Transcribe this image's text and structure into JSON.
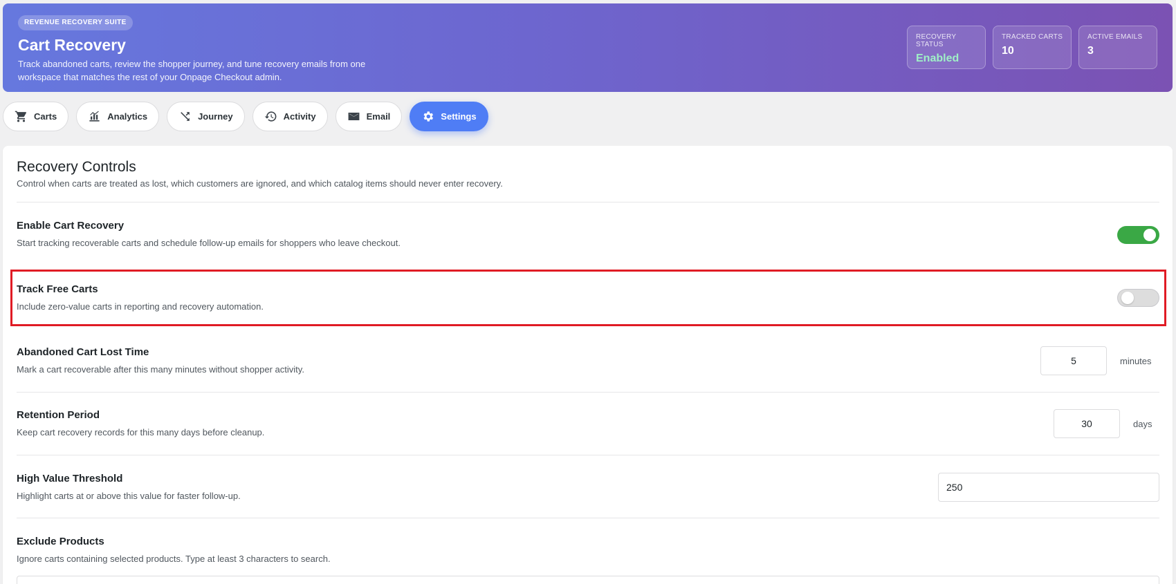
{
  "header": {
    "badge": "REVENUE RECOVERY SUITE",
    "title": "Cart Recovery",
    "description": "Track abandoned carts, review the shopper journey, and tune recovery emails from one workspace that matches the rest of your Onpage Checkout admin.",
    "stats": [
      {
        "label": "RECOVERY STATUS",
        "value": "Enabled"
      },
      {
        "label": "TRACKED CARTS",
        "value": "10"
      },
      {
        "label": "ACTIVE EMAILS",
        "value": "3"
      }
    ]
  },
  "tabs": [
    {
      "label": "Carts",
      "icon": "cart-icon"
    },
    {
      "label": "Analytics",
      "icon": "chart-icon"
    },
    {
      "label": "Journey",
      "icon": "shuffle-icon"
    },
    {
      "label": "Activity",
      "icon": "history-icon"
    },
    {
      "label": "Email",
      "icon": "mail-icon"
    },
    {
      "label": "Settings",
      "icon": "gear-icon",
      "active": true
    }
  ],
  "panel": {
    "title": "Recovery Controls",
    "description": "Control when carts are treated as lost, which customers are ignored, and which catalog items should never enter recovery.",
    "settings": {
      "enable_recovery": {
        "title": "Enable Cart Recovery",
        "description": "Start tracking recoverable carts and schedule follow-up emails for shoppers who leave checkout.",
        "enabled": true
      },
      "track_free": {
        "title": "Track Free Carts",
        "description": "Include zero-value carts in reporting and recovery automation.",
        "enabled": false
      },
      "lost_time": {
        "title": "Abandoned Cart Lost Time",
        "description": "Mark a cart recoverable after this many minutes without shopper activity.",
        "value": "5",
        "unit": "minutes"
      },
      "retention": {
        "title": "Retention Period",
        "description": "Keep cart recovery records for this many days before cleanup.",
        "value": "30",
        "unit": "days"
      },
      "high_value": {
        "title": "High Value Threshold",
        "description": "Highlight carts at or above this value for faster follow-up.",
        "value": "250"
      },
      "exclude_products": {
        "title": "Exclude Products",
        "description": "Ignore carts containing selected products. Type at least 3 characters to search."
      }
    }
  },
  "colors": {
    "accent": "#4f7df5",
    "toggle_on": "#3aa845",
    "highlight": "#e01b24",
    "status_enabled": "#9ff0c6"
  }
}
